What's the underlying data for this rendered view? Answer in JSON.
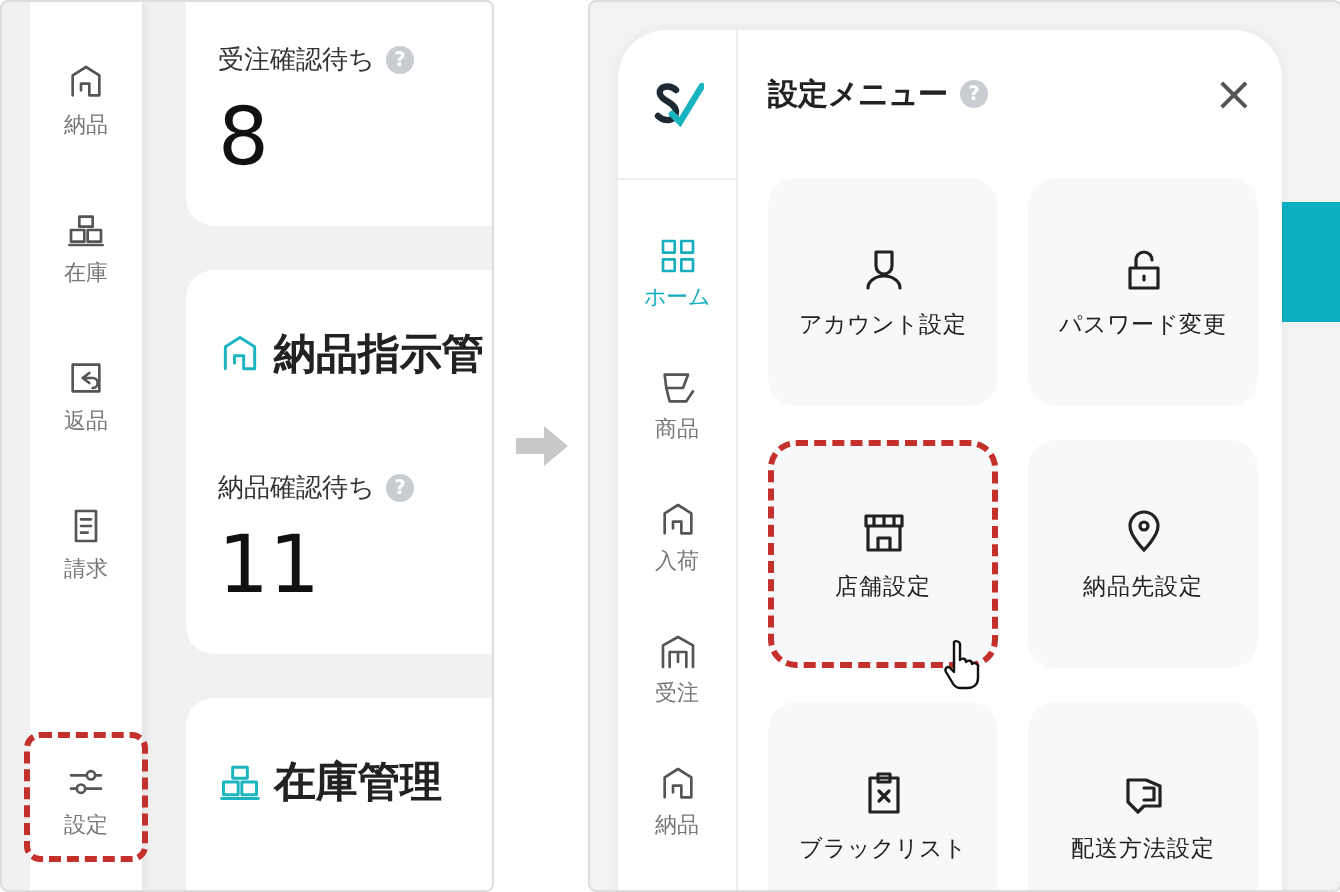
{
  "left_screen": {
    "sidebar": {
      "items": [
        {
          "label": "納品",
          "highlighted": false
        },
        {
          "label": "在庫",
          "highlighted": false
        },
        {
          "label": "返品",
          "highlighted": false
        },
        {
          "label": "請求",
          "highlighted": false
        },
        {
          "label": "設定",
          "highlighted": true
        }
      ]
    },
    "cards": [
      {
        "kind": "metric",
        "metric_label": "受注確認待ち",
        "help": "?",
        "value": "8"
      },
      {
        "kind": "section",
        "title": "納品指示管",
        "metric_label": "納品確認待ち",
        "help": "?",
        "value": "11"
      },
      {
        "kind": "section",
        "title": "在庫管理"
      }
    ]
  },
  "right_screen": {
    "menu": {
      "title": "設定メニュー",
      "help": "?",
      "close": "×",
      "nav": [
        {
          "label": "ホーム",
          "selected": true
        },
        {
          "label": "商品",
          "selected": false
        },
        {
          "label": "入荷",
          "selected": false
        },
        {
          "label": "受注",
          "selected": false
        },
        {
          "label": "納品",
          "selected": false
        }
      ],
      "tiles": [
        {
          "label": "アカウント設定",
          "highlighted": false
        },
        {
          "label": "パスワード変更",
          "highlighted": false
        },
        {
          "label": "店舗設定",
          "highlighted": true
        },
        {
          "label": "納品先設定",
          "highlighted": false
        },
        {
          "label": "ブラックリスト",
          "highlighted": false
        },
        {
          "label": "配送方法設定",
          "highlighted": false
        }
      ]
    }
  }
}
